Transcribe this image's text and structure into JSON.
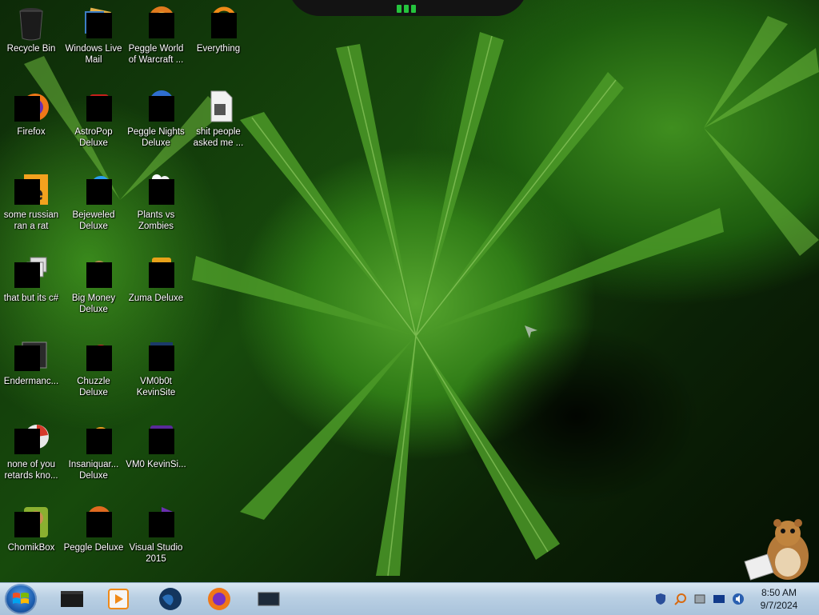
{
  "desktop": {
    "icons": [
      {
        "label": "Recycle Bin",
        "icon": "recycle-bin-icon"
      },
      {
        "label": "Windows Live Mail",
        "icon": "mail-icon"
      },
      {
        "label": "Peggle World of Warcraft ...",
        "icon": "peggle-wow-icon"
      },
      {
        "label": "Everything",
        "icon": "search-app-icon"
      },
      {
        "label": "Firefox",
        "icon": "firefox-icon"
      },
      {
        "label": "AstroPop Deluxe",
        "icon": "astropop-icon"
      },
      {
        "label": "Peggle Nights Deluxe",
        "icon": "peggle-nights-icon"
      },
      {
        "label": "shit people asked me ...",
        "icon": "document-icon"
      },
      {
        "label": "some russian ran a rat",
        "icon": "java-icon"
      },
      {
        "label": "Bejeweled Deluxe",
        "icon": "bejeweled-icon"
      },
      {
        "label": "Plants vs Zombies",
        "icon": "plants-vs-zombies-icon"
      },
      {
        "label": "that but its c#",
        "icon": "window-stack-icon"
      },
      {
        "label": "Big Money Deluxe",
        "icon": "money-bag-icon"
      },
      {
        "label": "Zuma Deluxe",
        "icon": "zuma-icon"
      },
      {
        "label": "Endermanc...",
        "icon": "console-icon"
      },
      {
        "label": "Chuzzle Deluxe",
        "icon": "chuzzle-icon"
      },
      {
        "label": "VM0b0t KevinSite",
        "icon": "vm-icon"
      },
      {
        "label": "none of you retards kno...",
        "icon": "chrome-icon"
      },
      {
        "label": "Insaniquar... Deluxe",
        "icon": "fish-icon"
      },
      {
        "label": "VM0 KevinSi...",
        "icon": "vm-purple-icon"
      },
      {
        "label": "ChomikBox",
        "icon": "hamster-app-icon"
      },
      {
        "label": "Peggle Deluxe",
        "icon": "peggle-icon"
      },
      {
        "label": "Visual Studio 2015",
        "icon": "visual-studio-icon"
      }
    ]
  },
  "taskbar": {
    "items": [
      {
        "icon": "terminal-window-icon"
      },
      {
        "icon": "media-player-icon"
      },
      {
        "icon": "globe-icon"
      },
      {
        "icon": "firefox-icon"
      },
      {
        "icon": "monitor-icon"
      }
    ],
    "tray": [
      {
        "icon": "shield-icon"
      },
      {
        "icon": "search-icon"
      },
      {
        "icon": "network-icon"
      },
      {
        "icon": "display-icon"
      },
      {
        "icon": "volume-icon"
      }
    ],
    "clock": {
      "time": "8:50 AM",
      "date": "9/7/2024"
    }
  },
  "colors": {
    "accent": "#1d5fb0",
    "taskbar": "#b9cfe3",
    "wallpaper": "#2f7b16"
  }
}
